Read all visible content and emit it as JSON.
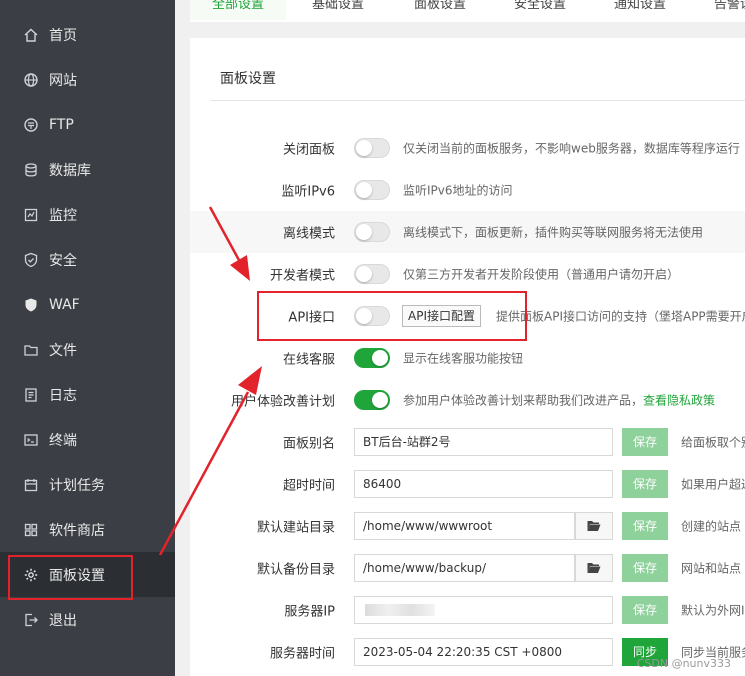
{
  "sidebar": {
    "items": [
      {
        "label": "首页",
        "icon": "home-icon"
      },
      {
        "label": "网站",
        "icon": "globe-icon"
      },
      {
        "label": "FTP",
        "icon": "ftp-icon"
      },
      {
        "label": "数据库",
        "icon": "database-icon"
      },
      {
        "label": "监控",
        "icon": "monitor-icon"
      },
      {
        "label": "安全",
        "icon": "shield-icon"
      },
      {
        "label": "WAF",
        "icon": "waf-shield-icon"
      },
      {
        "label": "文件",
        "icon": "folder-icon"
      },
      {
        "label": "日志",
        "icon": "log-icon"
      },
      {
        "label": "终端",
        "icon": "terminal-icon"
      },
      {
        "label": "计划任务",
        "icon": "calendar-icon"
      },
      {
        "label": "软件商店",
        "icon": "grid-icon"
      },
      {
        "label": "面板设置",
        "icon": "gear-icon"
      },
      {
        "label": "退出",
        "icon": "logout-icon"
      }
    ],
    "active_index": 12
  },
  "tabs": [
    {
      "label": "全部设置",
      "active": true
    },
    {
      "label": "基础设置"
    },
    {
      "label": "面板设置"
    },
    {
      "label": "安全设置"
    },
    {
      "label": "通知设置"
    },
    {
      "label": "告警设置"
    }
  ],
  "panel": {
    "title": "面板设置",
    "toggles": [
      {
        "label": "关闭面板",
        "on": false,
        "desc": "仅关闭当前的面板服务，不影响web服务器，数据库等程序运行"
      },
      {
        "label": "监听IPv6",
        "on": false,
        "desc": "监听IPv6地址的访问"
      },
      {
        "label": "离线模式",
        "on": false,
        "desc": "离线模式下，面板更新，插件购买等联网服务将无法使用"
      },
      {
        "label": "开发者模式",
        "on": false,
        "desc": "仅第三方开发者开发阶段使用（普通用户请勿开启）"
      },
      {
        "label": "API接口",
        "on": false,
        "button": "API接口配置",
        "desc": "提供面板API接口访问的支持（堡塔APP需要开启"
      },
      {
        "label": "在线客服",
        "on": true,
        "desc": "显示在线客服功能按钮"
      },
      {
        "label": "用户体验改善计划",
        "on": true,
        "desc": "参加用户体验改善计划来帮助我们改进产品，",
        "link": "查看隐私政策"
      }
    ],
    "fields": [
      {
        "label": "面板别名",
        "value": "BT后台-站群2号",
        "button": "保存",
        "hint": "给面板取个别名"
      },
      {
        "label": "超时时间",
        "value": "86400",
        "button": "保存",
        "hint": "如果用户超过"
      },
      {
        "label": "默认建站目录",
        "value": "/home/www/wwwroot",
        "button": "保存",
        "hint": "创建的站点"
      },
      {
        "label": "默认备份目录",
        "value": "/home/www/backup/",
        "button": "保存",
        "hint": "网站和站点"
      },
      {
        "label": "服务器IP",
        "value": "",
        "button": "保存",
        "hint": "默认为外网IP"
      },
      {
        "label": "服务器时间",
        "value": "2023-05-04 22:20:35 CST +0800",
        "button": "同步",
        "hint": "同步当前服务器"
      }
    ]
  },
  "watermark": "CSDN @nunv333",
  "colors": {
    "accent": "#20a53a",
    "annotation": "#e3232b",
    "sidebar_bg": "#3b3f45"
  }
}
